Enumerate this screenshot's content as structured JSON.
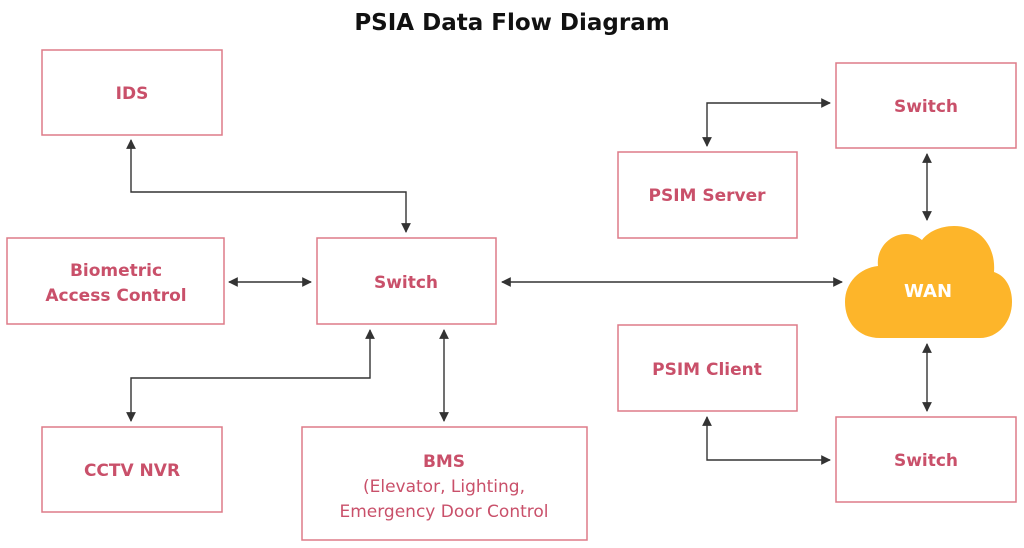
{
  "title": "PSIA Data Flow Diagram",
  "colors": {
    "box_border": "#dd7b88",
    "label": "#c9506a",
    "cloud": "#fdb52a",
    "arrow": "#333333"
  },
  "nodes": {
    "ids": "IDS",
    "biometric": [
      "Biometric",
      "Access Control"
    ],
    "switch_main": "Switch",
    "cctv": "CCTV NVR",
    "bms": [
      "BMS",
      "(Elevator, Lighting,",
      "Emergency Door Control"
    ],
    "psim_server": "PSIM Server",
    "psim_client": "PSIM Client",
    "switch_top": "Switch",
    "switch_bottom": "Switch",
    "wan": "WAN"
  }
}
